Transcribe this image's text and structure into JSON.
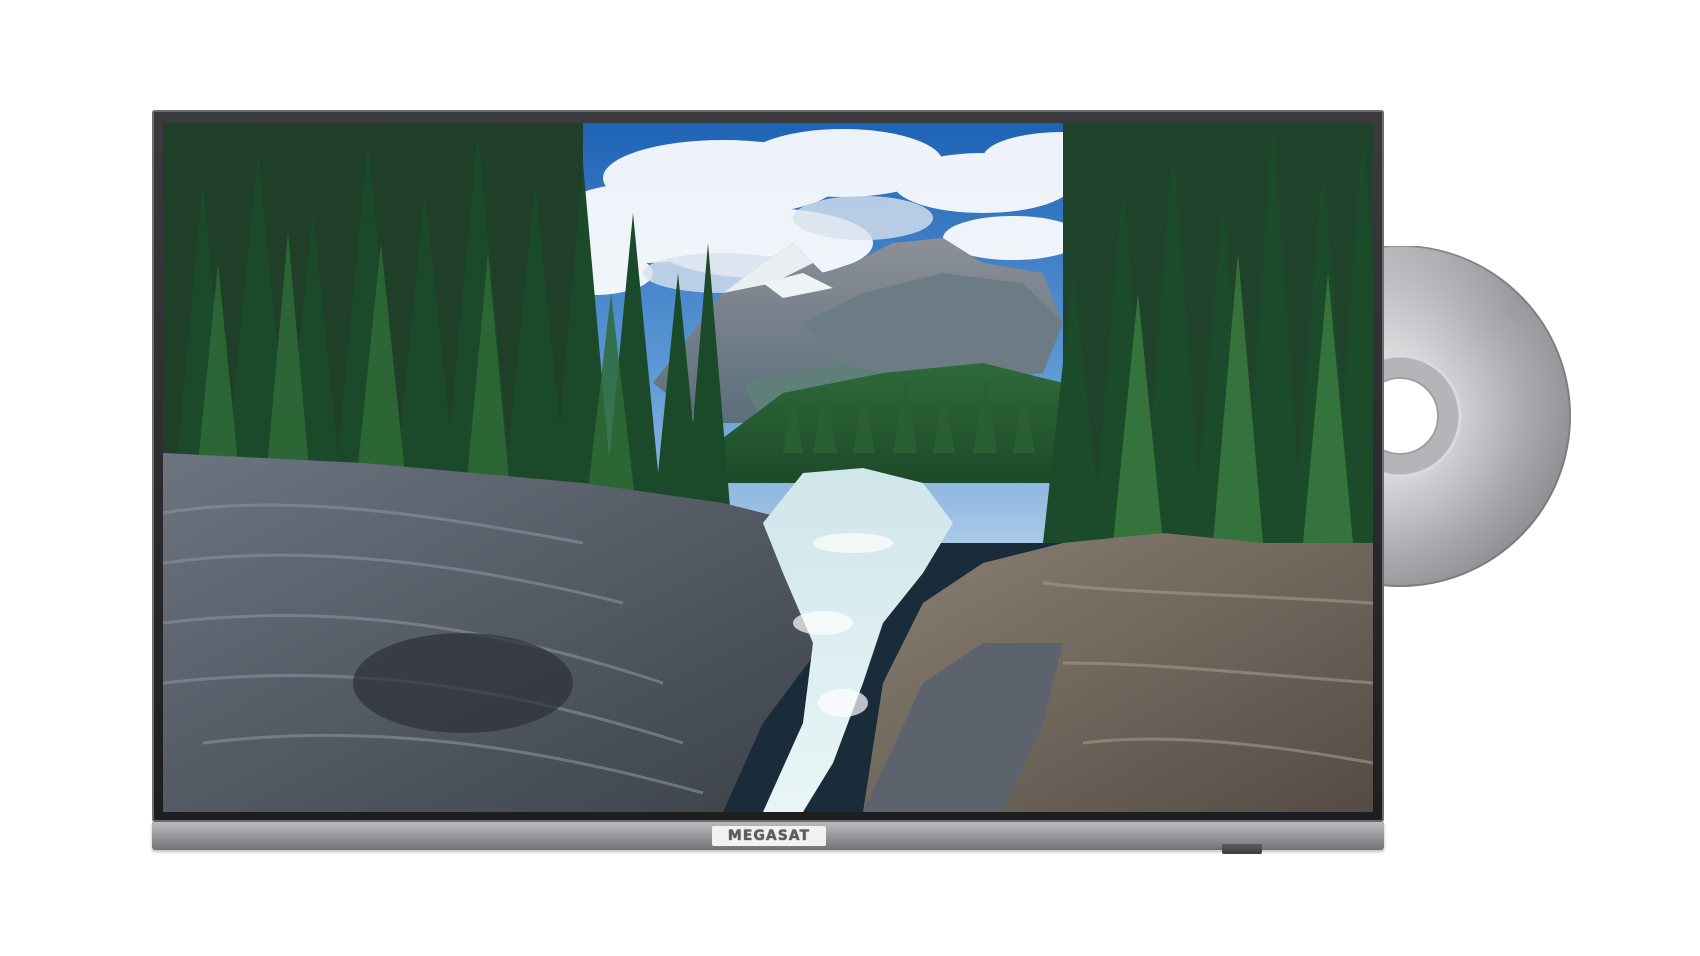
{
  "device": {
    "brand_logo_text": "MEGASAT",
    "type": "tv-with-dvd-player",
    "frame_color": "#2b2c2f",
    "bar_color": "#9a9ca0"
  },
  "screen_image": {
    "subject": "mountain-river-canyon-forest"
  },
  "disc": {
    "type": "optical-disc"
  }
}
